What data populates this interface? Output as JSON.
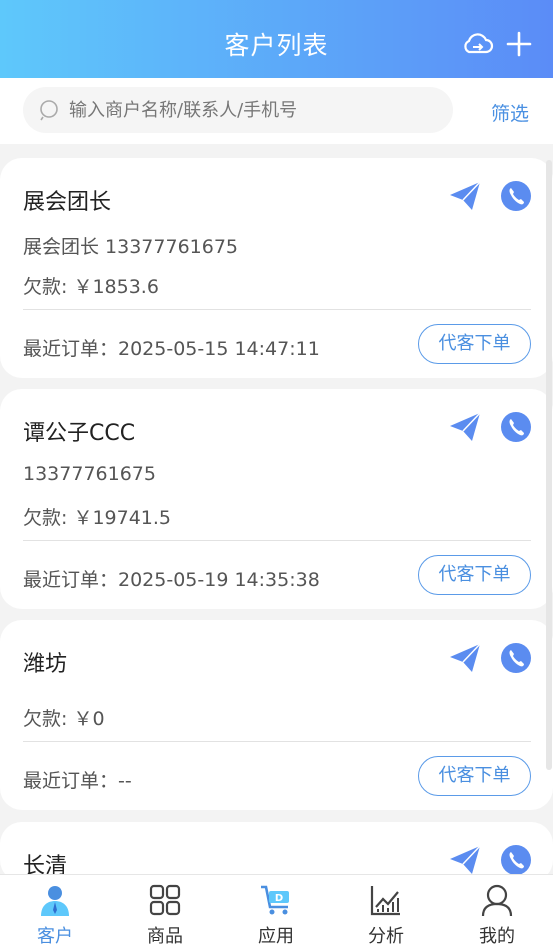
{
  "header": {
    "title": "客户列表"
  },
  "search": {
    "placeholder": "输入商户名称/联系人/手机号",
    "filter_label": "筛选"
  },
  "customers": [
    {
      "name": "展会团长",
      "contact": "展会团长 13377761675",
      "debt": "欠款: ￥1853.6",
      "last_order": "最近订单：2025-05-15 14:47:11",
      "action_label": "代客下单"
    },
    {
      "name": "谭公子CCC",
      "contact": "13377761675",
      "debt": "欠款: ￥19741.5",
      "last_order": "最近订单：2025-05-19 14:35:38",
      "action_label": "代客下单"
    },
    {
      "name": "潍坊",
      "contact": "",
      "debt": "欠款: ￥0",
      "last_order": "最近订单：--",
      "action_label": "代客下单"
    },
    {
      "name": "长清"
    }
  ],
  "tabs": [
    {
      "label": "客户",
      "icon": "customer-icon",
      "active": true
    },
    {
      "label": "商品",
      "icon": "grid-icon",
      "active": false
    },
    {
      "label": "应用",
      "icon": "cart-icon",
      "active": false
    },
    {
      "label": "分析",
      "icon": "chart-icon",
      "active": false
    },
    {
      "label": "我的",
      "icon": "user-icon",
      "active": false
    }
  ],
  "colors": {
    "accent": "#4a8fe0",
    "header_start": "#5ec8fb",
    "header_end": "#5b8cf7"
  }
}
